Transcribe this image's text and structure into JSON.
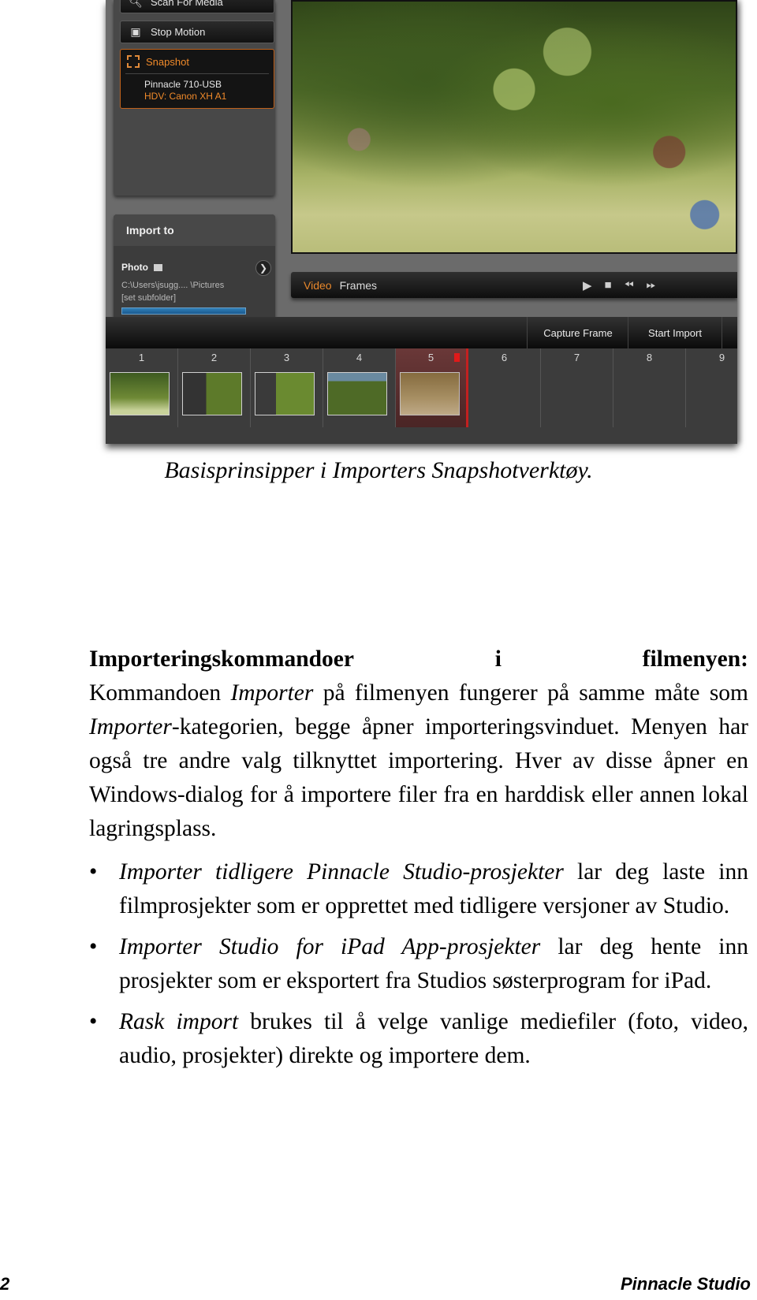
{
  "figure": {
    "left_panel": {
      "scan_button": "Scan For Media",
      "stop_motion_button": "Stop Motion",
      "snapshot_button": "Snapshot",
      "devices": [
        "Pinnacle 710-USB",
        "HDV: Canon XH A1"
      ]
    },
    "import_panel": {
      "title": "Import to",
      "photo_label": "Photo",
      "path": "C:\\Users\\jsugg....  \\Pictures",
      "subfolder": "[set subfolder]"
    },
    "transport": {
      "tab_video": "Video",
      "tab_frames": "Frames",
      "controls": [
        "play-icon",
        "stop-icon",
        "rewind-icon",
        "fast-forward-icon"
      ]
    },
    "capture_bar": {
      "capture_frame_button": "Capture Frame",
      "start_import_button": "Start Import"
    },
    "frames": [
      {
        "num": "1",
        "has_thumb": true
      },
      {
        "num": "2",
        "has_thumb": true
      },
      {
        "num": "3",
        "has_thumb": true
      },
      {
        "num": "4",
        "has_thumb": true
      },
      {
        "num": "5",
        "has_thumb": true,
        "selected": true
      },
      {
        "num": "6",
        "has_thumb": false
      },
      {
        "num": "7",
        "has_thumb": false
      },
      {
        "num": "8",
        "has_thumb": false
      },
      {
        "num": "9",
        "has_thumb": false
      }
    ],
    "colors": {
      "accent": "#f08a2a",
      "selection": "#c42020"
    }
  },
  "caption": "Basisprinsipper i Importers Snapshotverktøy.",
  "section": {
    "heading_parts": [
      "Importeringskommandoer",
      "i",
      "filmenyen:"
    ],
    "intro_1": "Kommandoen ",
    "intro_em1": "Importer",
    "intro_2": " på filmenyen fungerer på samme måte som ",
    "intro_em2": "Importer",
    "intro_3": "-kategorien, begge åpner importeringsvinduet. Menyen har også tre andre valg tilknyttet importering. Hver av disse åpner en Windows-dialog for å importere filer fra en harddisk eller annen lokal lagringsplass.",
    "bullets": [
      {
        "em": "Importer tidligere Pinnacle Studio-prosjekter",
        "text": " lar deg laste inn filmprosjekter som er opprettet med tidligere versjoner av Studio."
      },
      {
        "em": "Importer Studio for iPad App-prosjekter",
        "text": " lar deg hente inn prosjekter som er eksportert fra Studios søsterprogram for iPad."
      },
      {
        "em": "Rask import",
        "text": " brukes til å velge vanlige mediefiler (foto, video, audio, prosjekter) direkte og importere dem."
      }
    ]
  },
  "footer": {
    "page_number": "2",
    "book_title": "Pinnacle Studio"
  }
}
